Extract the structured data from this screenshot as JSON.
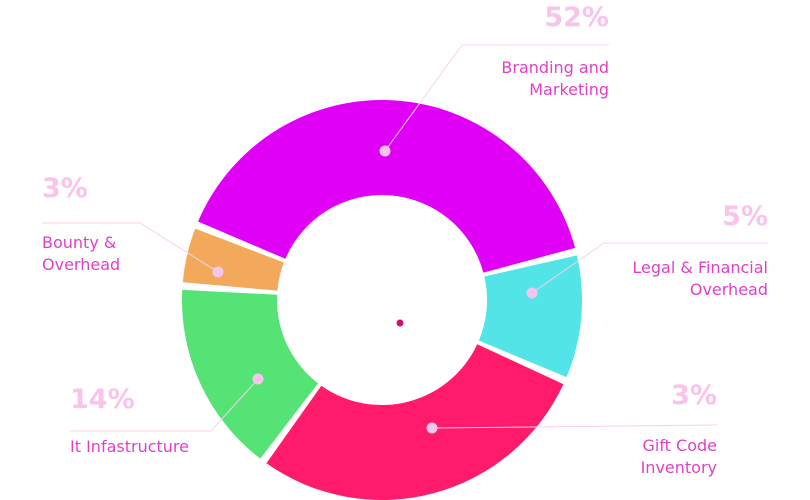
{
  "chart_data": {
    "type": "pie",
    "style": "donut",
    "slices": [
      {
        "name": "Branding and Marketing",
        "label_lines": [
          "Branding and",
          "Marketing"
        ],
        "percent_label": "52%",
        "value": 52,
        "color": "#e000f5"
      },
      {
        "name": "Legal & Financial Overhead",
        "label_lines": [
          "Legal & Financial",
          "Overhead"
        ],
        "percent_label": "5%",
        "value": 5,
        "color": "#52e4e6"
      },
      {
        "name": "Gift Code Inventory",
        "label_lines": [
          "Gift Code",
          "Inventory"
        ],
        "percent_label": "3%",
        "value": 3,
        "color": "#ff1a6a"
      },
      {
        "name": "It Infastructure",
        "label_lines": [
          "It Infastructure"
        ],
        "percent_label": "14%",
        "value": 14,
        "color": "#55e375"
      },
      {
        "name": "Bounty & Overhead",
        "label_lines": [
          "Bounty &",
          "Overhead"
        ],
        "percent_label": "3%",
        "value": 3,
        "color": "#f2a95b"
      }
    ],
    "legend": "none"
  }
}
